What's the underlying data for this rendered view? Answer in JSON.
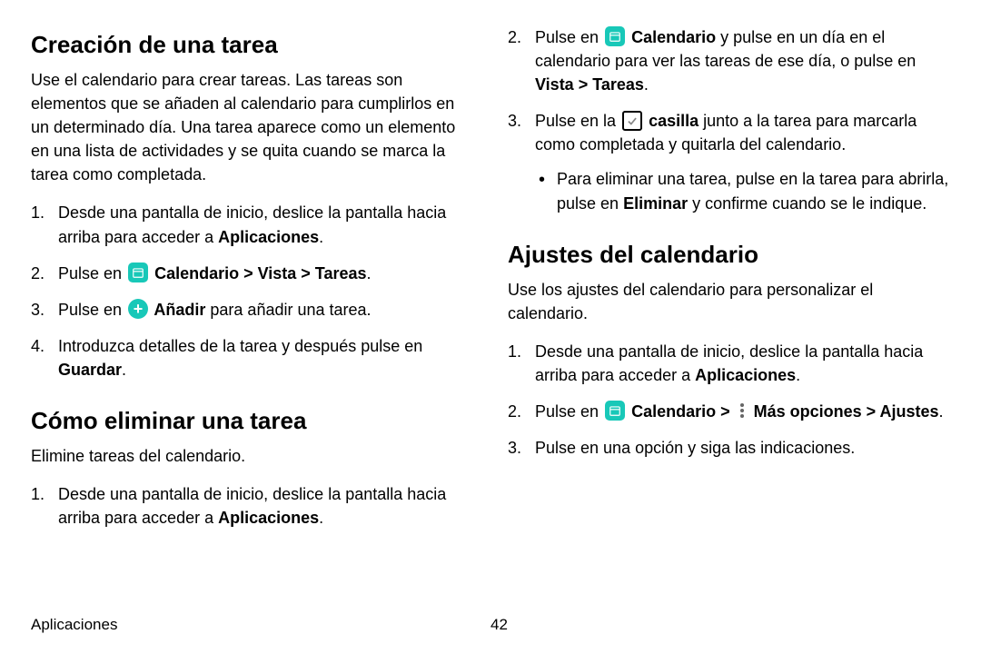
{
  "colors": {
    "accent": "#18c8b8"
  },
  "icons": {
    "calendar": "calendar-icon",
    "add": "add-icon",
    "check": "checkbox-icon",
    "more": "more-options-icon"
  },
  "sec1": {
    "heading": "Creación de una tarea",
    "intro": "Use el calendario para crear tareas. Las tareas son elementos que se añaden al calendario para cumplirlos en un determinado día. Una tarea aparece como un elemento en una lista de actividades y se quita cuando se marca la tarea como completada.",
    "li1a": "Desde una pantalla de inicio, deslice la pantalla hacia arriba para acceder a ",
    "li1b": "Aplicaciones",
    "li1c": ".",
    "li2a": "Pulse en ",
    "li2b": " Calendario > Vista > Tareas",
    "li2c": ".",
    "li3a": "Pulse en ",
    "li3b": " Añadir",
    "li3c": " para añadir una tarea.",
    "li4a": "Introduzca detalles de la tarea y después pulse en ",
    "li4b": "Guardar",
    "li4c": "."
  },
  "sec2": {
    "heading": "Cómo eliminar una tarea",
    "intro": "Elimine tareas del calendario.",
    "li1a": "Desde una pantalla de inicio, deslice la pantalla hacia arriba para acceder a ",
    "li1b": "Aplicaciones",
    "li1c": ".",
    "li2a": "Pulse en ",
    "li2b": " Calendario",
    "li2c": " y pulse en un día en el calendario para ver las tareas de ese día, o pulse en ",
    "li2d": "Vista > Tareas",
    "li2e": ".",
    "li3a": "Pulse en la ",
    "li3b": " casilla",
    "li3c": " junto a la tarea para marcarla como completada y quitarla del calendario.",
    "sub_a": "Para eliminar una tarea, pulse en la tarea para abrirla, pulse en ",
    "sub_b": "Eliminar",
    "sub_c": " y confirme cuando se le indique."
  },
  "sec3": {
    "heading": "Ajustes del calendario",
    "intro": "Use los ajustes del calendario para personalizar el calendario.",
    "li1a": "Desde una pantalla de inicio, deslice la pantalla hacia arriba para acceder a ",
    "li1b": "Aplicaciones",
    "li1c": ".",
    "li2a": "Pulse en ",
    "li2b": " Calendario > ",
    "li2c": " Más opciones > Ajustes",
    "li2d": ".",
    "li3": "Pulse en una opción y siga las indicaciones."
  },
  "footer": {
    "section": "Aplicaciones",
    "page": "42"
  }
}
